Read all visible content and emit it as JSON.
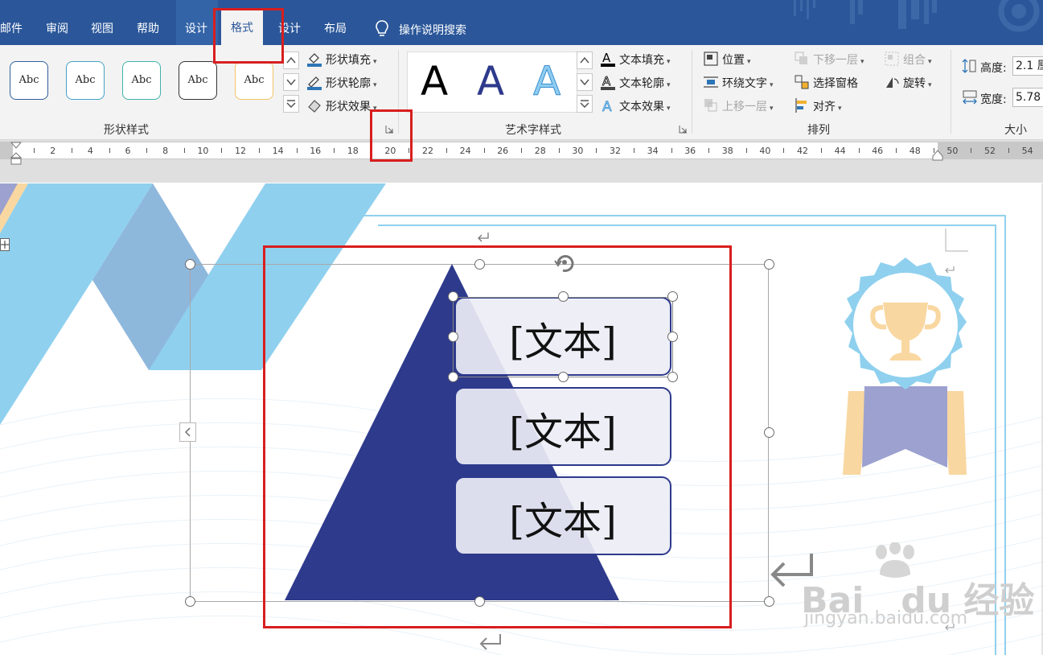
{
  "tabs": [
    "邮件",
    "审阅",
    "视图",
    "帮助",
    "设计",
    "格式",
    "设计",
    "布局"
  ],
  "tell_me": "操作说明搜索",
  "ribbon": {
    "shape_styles": {
      "label": "形状样式",
      "thumbnails": [
        "Abc",
        "Abc",
        "Abc",
        "Abc",
        "Abc"
      ],
      "fill": "形状填充",
      "outline": "形状轮廓",
      "effects": "形状效果"
    },
    "wordart": {
      "label": "艺术字样式",
      "samples": [
        "A",
        "A",
        "A"
      ],
      "text_fill": "文本填充",
      "text_outline": "文本轮廓",
      "text_effects": "文本效果"
    },
    "arrange": {
      "label": "排列",
      "position": "位置",
      "wrap_text": "环绕文字",
      "bring_forward": "上移一层",
      "send_backward": "下移一层",
      "selection_pane": "选择窗格",
      "align": "对齐",
      "group": "组合",
      "rotate": "旋转"
    },
    "size": {
      "label": "大小",
      "height_label": "高度:",
      "height_value": "2.1 厘",
      "width_label": "宽度:",
      "width_value": "5.78"
    }
  },
  "ruler": {
    "numbers": [
      "2",
      "4",
      "6",
      "8",
      "10",
      "12",
      "14",
      "16",
      "18",
      "20",
      "22",
      "24",
      "26",
      "28",
      "30",
      "32",
      "34",
      "36",
      "38",
      "40",
      "42",
      "44",
      "46",
      "48",
      "50",
      "52",
      "54"
    ]
  },
  "smartart": {
    "boxes": [
      "[文本]",
      "[文本]",
      "[文本]"
    ]
  },
  "watermark": {
    "brand": "Bai   du 经验",
    "url": "jingyan.baidu.com"
  },
  "colors": {
    "tab_bar": "#2b579a",
    "ribbon_bg": "#f3f3f3",
    "annotation": "#d81e1e",
    "triangle": "#2e3a8c",
    "light_blue": "#8fd0ee",
    "badge_orange": "#f9d7a0",
    "badge_purple": "#9ca1cf"
  }
}
